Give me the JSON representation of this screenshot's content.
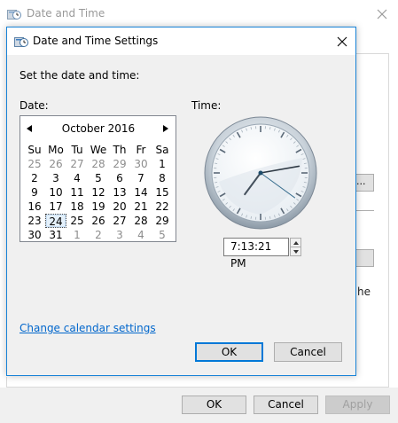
{
  "parent_window": {
    "title": "Date and Time",
    "side_text_fragment": "he",
    "side_button_fragment": "...",
    "buttons": {
      "ok": "OK",
      "cancel": "Cancel",
      "apply": "Apply"
    }
  },
  "dialog": {
    "title": "Date and Time Settings",
    "instruction": "Set the date and time:",
    "date_label": "Date:",
    "time_label": "Time:",
    "calendar": {
      "month_year": "October 2016",
      "weekdays": [
        "Su",
        "Mo",
        "Tu",
        "We",
        "Th",
        "Fr",
        "Sa"
      ],
      "weeks": [
        [
          "25",
          "26",
          "27",
          "28",
          "29",
          "30",
          "1"
        ],
        [
          "2",
          "3",
          "4",
          "5",
          "6",
          "7",
          "8"
        ],
        [
          "9",
          "10",
          "11",
          "12",
          "13",
          "14",
          "15"
        ],
        [
          "16",
          "17",
          "18",
          "19",
          "20",
          "21",
          "22"
        ],
        [
          "23",
          "24",
          "25",
          "26",
          "27",
          "28",
          "29"
        ],
        [
          "30",
          "31",
          "1",
          "2",
          "3",
          "4",
          "5"
        ]
      ],
      "selected_day": "24"
    },
    "clock": {
      "hour": 7,
      "minute": 13,
      "second": 21
    },
    "time_value": "7:13:21 PM",
    "change_calendar_link": "Change calendar settings",
    "buttons": {
      "ok": "OK",
      "cancel": "Cancel"
    }
  },
  "colors": {
    "accent": "#0078d7",
    "link": "#0066cc",
    "dialog_bg": "#f0f0f0",
    "border_accent": "#1883d7"
  },
  "icons": {
    "app_icon": "date-time-settings-icon",
    "close": "close-icon",
    "prev_month": "triangle-left-icon",
    "next_month": "triangle-right-icon",
    "spin_up": "spin-up-icon",
    "spin_down": "spin-down-icon"
  }
}
